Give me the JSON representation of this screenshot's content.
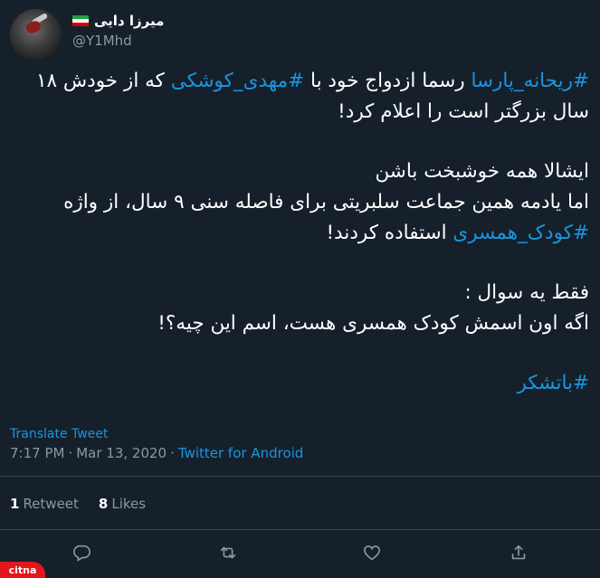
{
  "author": {
    "display_name": "میرزا دایی",
    "handle": "@Y1Mhd",
    "flag_icon": "iran-flag-icon"
  },
  "tweet": {
    "line1_hashtag1": "#ریحانه_پارسا",
    "line1_mid": " رسما ازدواج خود با ",
    "line1_hashtag2": "#مهدی_کوشکی",
    "line1_end": " که از خودش ۱۸ سال بزرگتر است را اعلام کرد!",
    "para2": "ایشالا همه خوشبخت باشن",
    "para3_start": "اما یادمه همین جماعت سلبریتی برای فاصله سنی ۹ سال، از واژه ",
    "para3_hashtag": "#کودک_همسری",
    "para3_end": " استفاده کردند!",
    "para4_line1": "فقط یه سوال :",
    "para4_line2": "اگه اون اسمش کودک همسری هست، اسم این چیه؟!",
    "final_hashtag": "#باتشکر"
  },
  "translate_label": "Translate Tweet",
  "meta": {
    "time": "7:17 PM",
    "separator1": "·",
    "date": "Mar 13, 2020",
    "separator2": "·",
    "source": "Twitter for Android"
  },
  "stats": {
    "retweets_count": "1",
    "retweets_label": "Retweet",
    "likes_count": "8",
    "likes_label": "Likes"
  },
  "actions": [
    "reply-icon",
    "retweet-icon",
    "like-icon",
    "share-icon"
  ],
  "watermark": "citna",
  "colors": {
    "background": "#15202b",
    "link": "#1b95e0",
    "secondary_text": "#8899a6",
    "divider": "#38444d"
  }
}
